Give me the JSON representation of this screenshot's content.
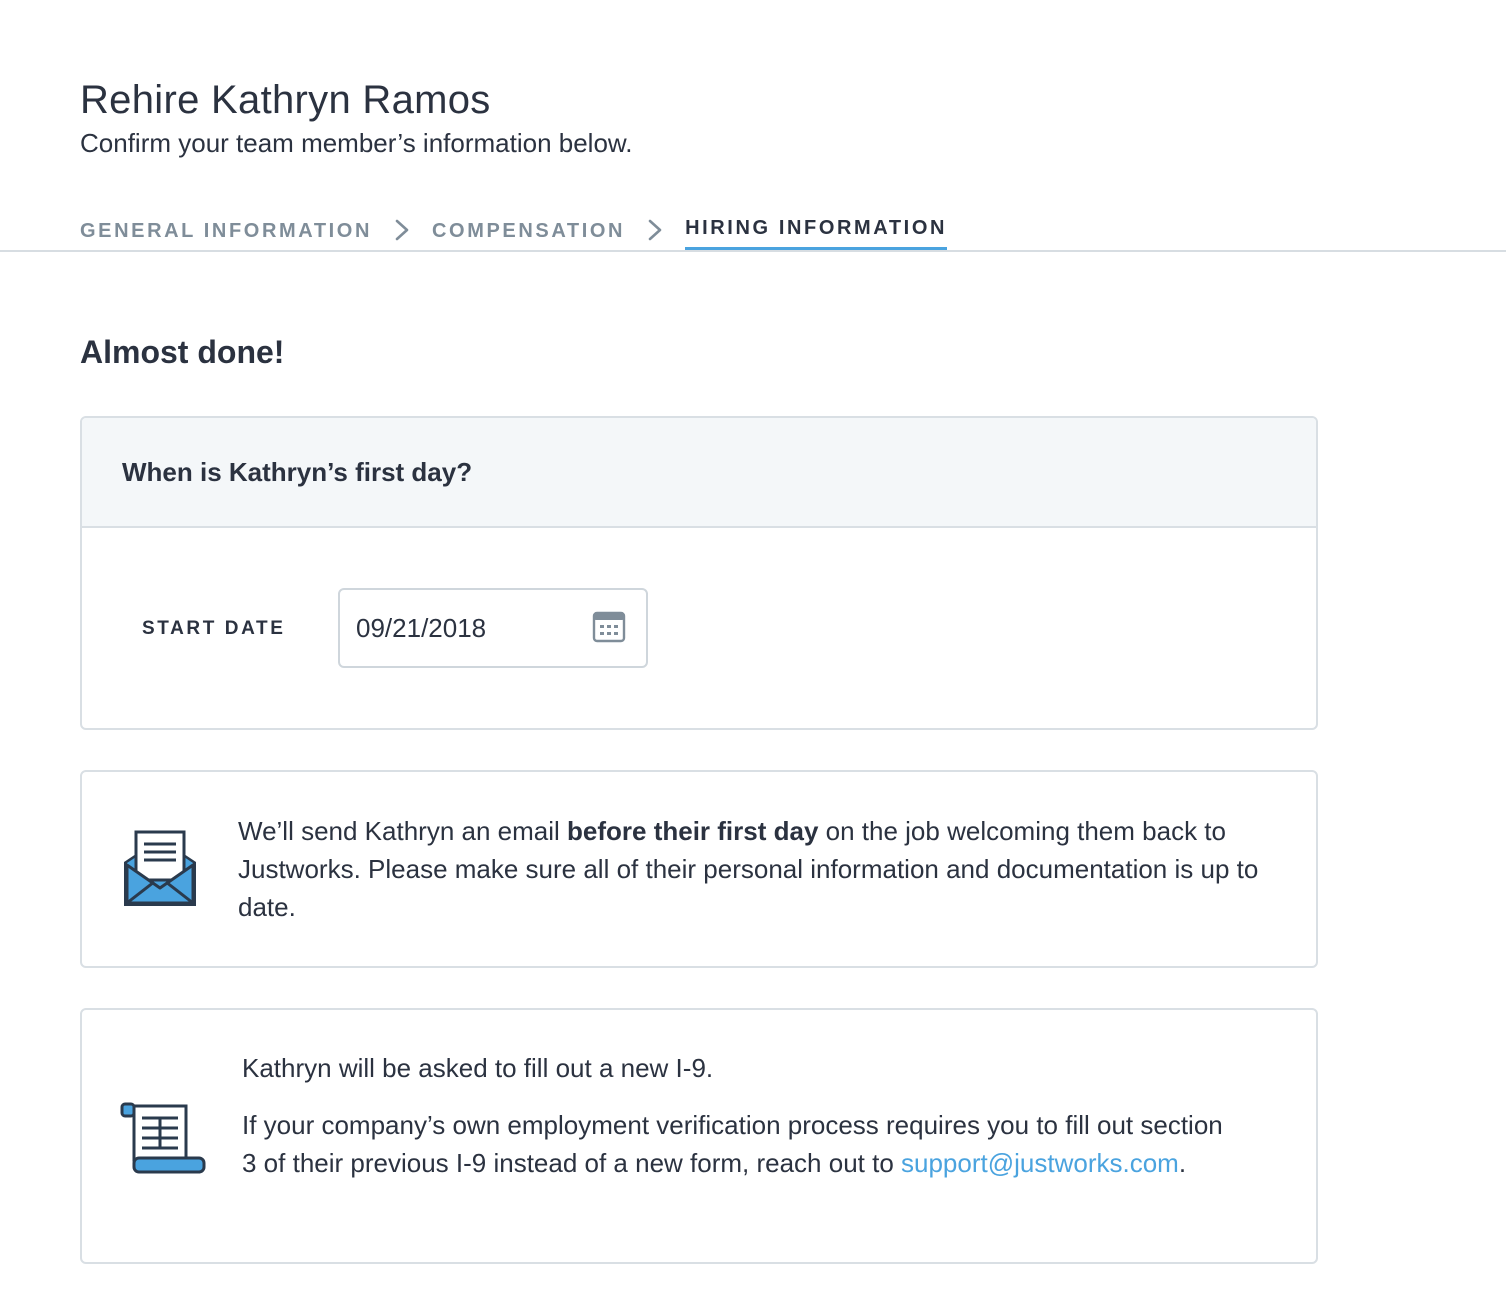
{
  "header": {
    "title": "Rehire Kathryn Ramos",
    "subtitle": "Confirm your team member’s information below."
  },
  "steps": [
    {
      "label": "GENERAL INFORMATION",
      "active": false
    },
    {
      "label": "COMPENSATION",
      "active": false
    },
    {
      "label": "HIRING INFORMATION",
      "active": true
    }
  ],
  "section_heading": "Almost done!",
  "first_day_card": {
    "title": "When is Kathryn’s first day?",
    "start_date_label": "START DATE",
    "start_date_value": "09/21/2018"
  },
  "email_card": {
    "text_before": "We’ll send Kathryn an email ",
    "text_bold": "before their first day",
    "text_after": " on the job welcoming them back to Justworks. Please make sure all of their personal information and documentation is up to date."
  },
  "i9_card": {
    "line1": "Kathryn will be asked to fill out a new I-9.",
    "line2_text": "If your company’s own employment verification process requires you to fill out section 3 of their previous I-9 instead of a new form, reach out to ",
    "support_email": "support@justworks.com",
    "line2_end": "."
  },
  "icons": {
    "step_separator": "chevron-right-icon",
    "calendar": "calendar-icon",
    "email": "envelope-letter-icon",
    "form": "scroll-form-icon"
  },
  "colors": {
    "accent": "#4aa3df",
    "text": "#2b3240",
    "muted": "#7f8d99",
    "border": "#d9dfe4",
    "header_bg": "#f4f7f9"
  }
}
